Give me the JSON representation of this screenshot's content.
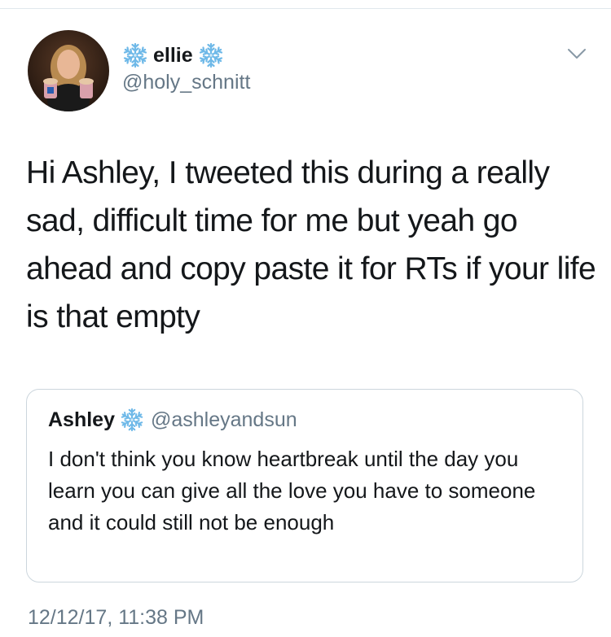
{
  "tweet": {
    "author": {
      "display_name": "ellie",
      "handle": "@holy_schnitt",
      "name_decoration_icon": "snowflake-icon"
    },
    "menu_icon": "chevron-down-icon",
    "text": "Hi Ashley, I tweeted this during a really sad, difficult time for me but yeah go ahead and copy paste it for RTs if your life is that empty",
    "quoted_tweet": {
      "display_name": "Ashley",
      "handle": "@ashleyandsun",
      "name_decoration_icon": "snowflake-icon",
      "text": "I don't think you know heartbreak until the day you learn you can give all the love you have to someone and it could still not be enough"
    },
    "timestamp": "12/12/17, 11:38 PM"
  },
  "colors": {
    "primary_text": "#14171a",
    "secondary_text": "#657786",
    "snowflake": "#6fb9e8",
    "border": "#ccd6dd"
  }
}
